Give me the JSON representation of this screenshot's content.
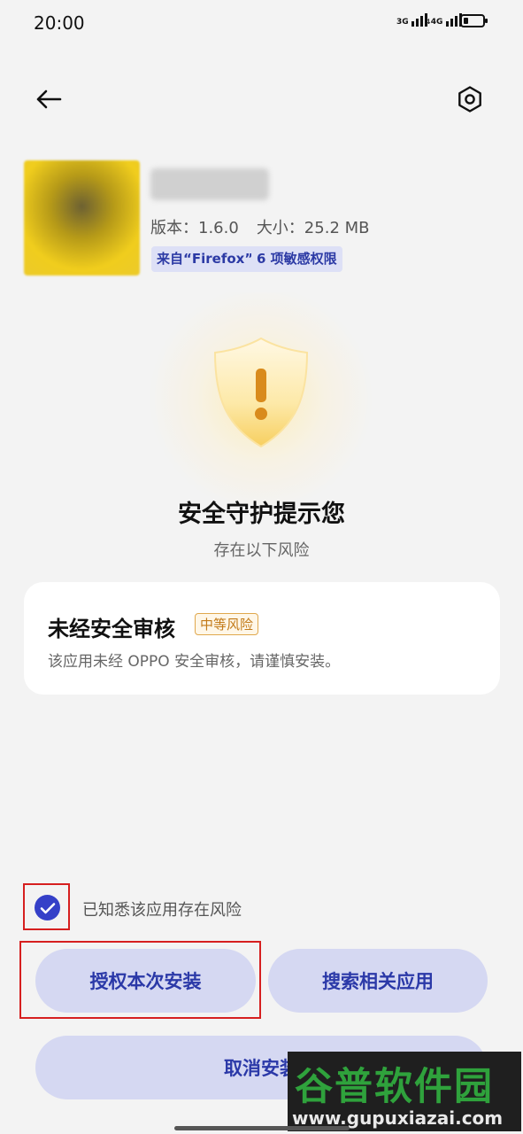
{
  "status_bar": {
    "time": "20:00",
    "signal1_label": "3G",
    "signal2_label": "4G"
  },
  "app": {
    "version": "版本：1.6.0",
    "size": "大小：25.2 MB",
    "source_tag": "来自“Firefox”",
    "permission_tag": "6 项敏感权限"
  },
  "security": {
    "title": "安全守护提示您",
    "subtitle": "存在以下风险"
  },
  "risk_card": {
    "title": "未经安全审核",
    "badge": "中等风险",
    "description": "该应用未经 OPPO 安全审核，请谨慎安装。"
  },
  "acknowledge": {
    "label": "已知悉该应用存在风险",
    "checked": true
  },
  "buttons": {
    "authorize": "授权本次安装",
    "search": "搜索相关应用",
    "cancel": "取消安装"
  },
  "watermark": {
    "brand": "谷普软件园",
    "url": "www.gupuxiazai.com"
  },
  "colors": {
    "accent": "#3540c8",
    "button_bg": "#d5d8f2",
    "button_text": "#2b39a8",
    "highlight_outline": "#d61f1f",
    "risk_badge": "#c27a18"
  }
}
